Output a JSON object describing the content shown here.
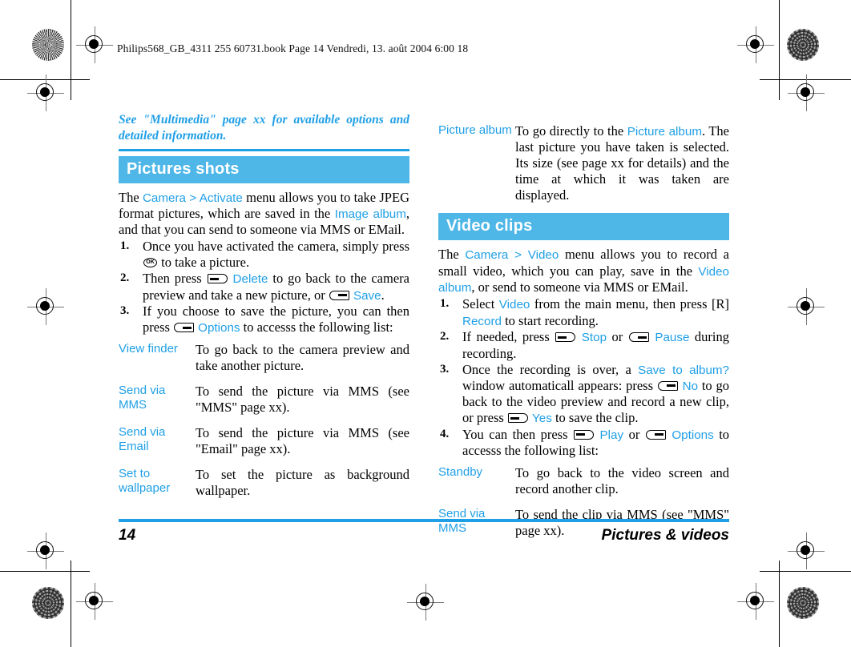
{
  "print_header": "Philips568_GB_4311 255 60731.book  Page 14  Vendredi, 13. août 2004  6:00 18",
  "colors": {
    "accent_blue": "#1F9FE6",
    "section_bar_blue": "#4FB7E8",
    "text_black": "#000000"
  },
  "left_column": {
    "intro_note": "See \"Multimedia\" page xx for available options and detailed information.",
    "section_title": "Pictures shots",
    "intro_paragraph": {
      "part1": "The ",
      "kw1": "Camera",
      "sep": " > ",
      "kw2": "Activate",
      "part2": " menu allows you to take JPEG format pictures, which are saved in the ",
      "kw3": "Image album",
      "part3": ", and that you can send to someone via MMS or EMail."
    },
    "steps": [
      {
        "num": "1.",
        "t1": "Once you have activated the camera, simply press ",
        "key1": "ok-key",
        "t2": " to take a picture."
      },
      {
        "num": "2.",
        "t1": "Then press ",
        "key1": "softkey-left",
        "kw1": "Delete",
        "t2": " to go back to the camera preview and take a new picture, or ",
        "key2": "softkey-right",
        "kw2": "Save",
        "t3": "."
      },
      {
        "num": "3.",
        "t1": "If you choose to save the picture, you can then press ",
        "key1": "softkey-right",
        "kw1": "Options",
        "t2": " to accesss the following list:"
      }
    ],
    "options": [
      {
        "name": "View finder",
        "desc": "To go back to the camera preview and take another picture."
      },
      {
        "name": "Send via MMS",
        "desc": "To send the picture via MMS (see \"MMS\" page xx)."
      },
      {
        "name": "Send via Email",
        "desc": "To send the picture via MMS (see \"Email\" page xx)."
      },
      {
        "name": "Set to wallpaper",
        "desc": "To set the picture as background wallpaper."
      }
    ]
  },
  "right_column": {
    "top_option": {
      "name": "Picture album",
      "d1": "To go directly to the ",
      "kw1": "Picture album",
      "d2": ". The last picture you have taken is selected. Its size (see page xx for details) and the time at which it was taken are displayed."
    },
    "section_title": "Video clips",
    "intro_paragraph": {
      "part1": "The ",
      "kw1": "Camera",
      "sep": " > ",
      "kw2": "Video",
      "part2": " menu allows you to record a small video, which you can play, save in the ",
      "kw3": "Video album",
      "part3": ", or send to someone via MMS or EMail."
    },
    "steps": [
      {
        "num": "1.",
        "t1": "Select ",
        "kw1": "Video",
        "t2": " from the main menu, then press [R] ",
        "kw2": "Record",
        "t3": " to start recording."
      },
      {
        "num": "2.",
        "t1": "If needed, press ",
        "key1": "softkey-left",
        "kw1": "Stop",
        "t2": " or ",
        "key2": "softkey-right",
        "kw2": "Pause",
        "t3": " during recording."
      },
      {
        "num": "3.",
        "t1": "Once the recording is over, a ",
        "kw1": "Save to album?",
        "t2": " window automaticall appears: press ",
        "key1": "softkey-right",
        "kw2": "No",
        "t3": " to go back to the video preview and record a new clip, or press ",
        "key2": "softkey-left",
        "kw3": "Yes",
        "t4": " to save the clip."
      },
      {
        "num": "4.",
        "t1": "You can then press ",
        "key1": "softkey-left",
        "kw1": "Play",
        "t2": " or ",
        "key2": "softkey-right",
        "kw2": "Options",
        "t3": " to accesss the following list:"
      }
    ],
    "options": [
      {
        "name": "Standby",
        "desc": "To go back to the video screen and record another clip."
      },
      {
        "name": "Send via MMS",
        "desc": "To send the clip via MMS (see \"MMS\" page xx)."
      }
    ]
  },
  "footer": {
    "page_number": "14",
    "chapter": "Pictures & videos"
  },
  "ok_key_label": "OK"
}
